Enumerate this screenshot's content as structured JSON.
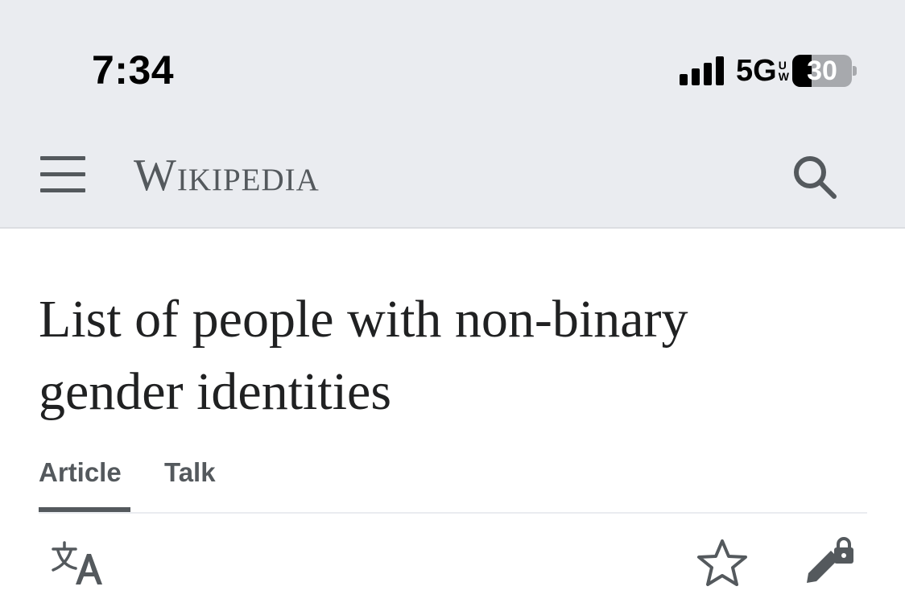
{
  "status_bar": {
    "time": "7:34",
    "network": "5G",
    "network_sub_top": "U",
    "network_sub_bottom": "W",
    "battery": "30"
  },
  "header": {
    "logo_text": "Wikipedia",
    "icons": [
      "hamburger-menu-icon",
      "search-icon"
    ]
  },
  "page": {
    "title": "List of people with non-binary gender identities",
    "tabs": [
      {
        "label": "Article",
        "active": true
      },
      {
        "label": "Talk",
        "active": false
      }
    ]
  },
  "toolbar": {
    "icons": [
      "language-icon",
      "watch-star-icon",
      "edit-locked-icon"
    ]
  },
  "colors": {
    "chrome_bg": "#eaecf0",
    "icon_gray": "#54595d",
    "text": "#202122"
  }
}
